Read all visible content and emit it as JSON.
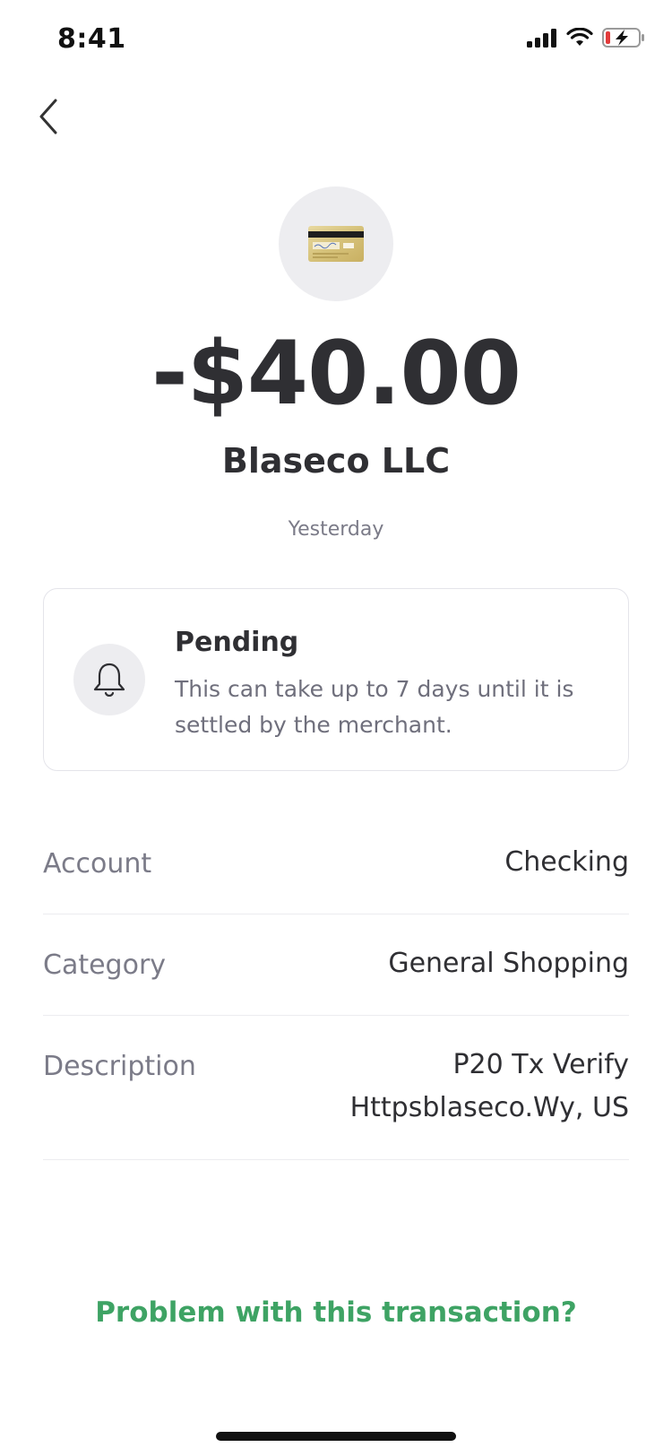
{
  "status_bar": {
    "time": "8:41"
  },
  "header": {
    "back_icon": "chevron-left-icon"
  },
  "transaction": {
    "icon": "credit-card-icon",
    "amount": "-$40.00",
    "merchant": "Blaseco LLC",
    "date": "Yesterday"
  },
  "pending": {
    "icon": "bell-icon",
    "title": "Pending",
    "description": "This can take up to 7 days until it is settled by the merchant."
  },
  "details": [
    {
      "label": "Account",
      "value": "Checking"
    },
    {
      "label": "Category",
      "value": "General Shopping"
    },
    {
      "label": "Description",
      "value": "P20 Tx Verify Httpsblaseco.Wy, US"
    }
  ],
  "actions": {
    "problem_label": "Problem with this transaction?"
  },
  "colors": {
    "accent": "#3ea364",
    "text_primary": "#2f2f33",
    "text_secondary": "#7b7b88",
    "card_border": "#e4e4ea"
  }
}
